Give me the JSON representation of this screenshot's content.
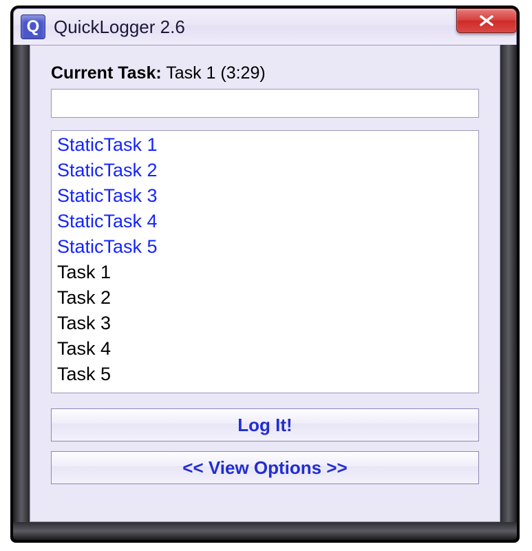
{
  "window": {
    "title": "QuickLogger 2.6",
    "icon_letter": "Q"
  },
  "current_task": {
    "label": "Current Task:",
    "value": "Task 1 (3:29)"
  },
  "input": {
    "value": ""
  },
  "task_list": [
    {
      "label": "StaticTask 1",
      "static": true
    },
    {
      "label": "StaticTask 2",
      "static": true
    },
    {
      "label": "StaticTask 3",
      "static": true
    },
    {
      "label": "StaticTask 4",
      "static": true
    },
    {
      "label": "StaticTask 5",
      "static": true
    },
    {
      "label": "Task 1",
      "static": false
    },
    {
      "label": "Task 2",
      "static": false
    },
    {
      "label": "Task 3",
      "static": false
    },
    {
      "label": "Task 4",
      "static": false
    },
    {
      "label": "Task 5",
      "static": false
    }
  ],
  "buttons": {
    "log_it": "Log It!",
    "view_options": "<< View Options >>"
  }
}
